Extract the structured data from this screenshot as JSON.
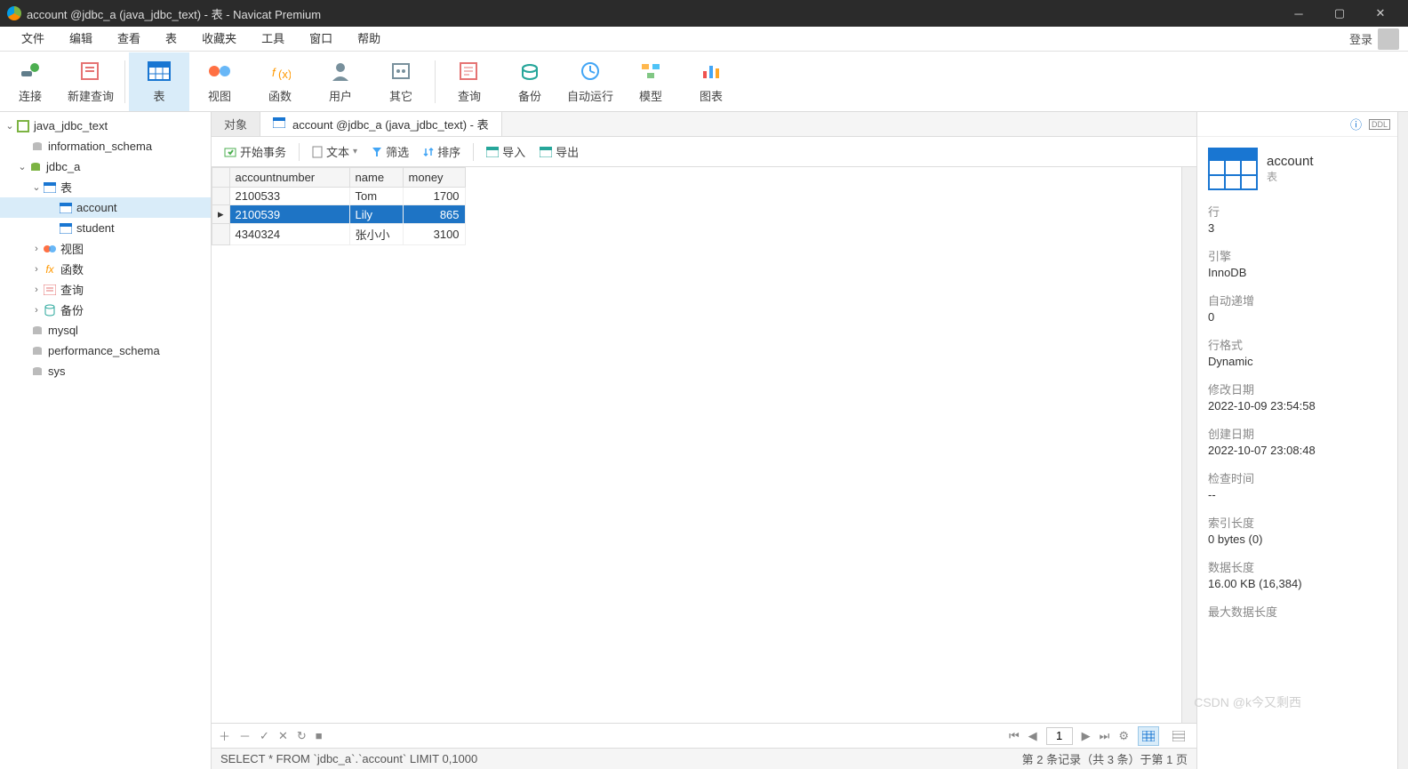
{
  "title": "account @jdbc_a (java_jdbc_text) - 表 - Navicat Premium",
  "menu": [
    "文件",
    "编辑",
    "查看",
    "表",
    "收藏夹",
    "工具",
    "窗口",
    "帮助"
  ],
  "login": "登录",
  "ribbon": [
    {
      "label": "连接",
      "name": "connect"
    },
    {
      "label": "新建查询",
      "name": "new-query"
    },
    {
      "label": "表",
      "name": "table",
      "active": true
    },
    {
      "label": "视图",
      "name": "view"
    },
    {
      "label": "函数",
      "name": "function"
    },
    {
      "label": "用户",
      "name": "user"
    },
    {
      "label": "其它",
      "name": "other"
    },
    {
      "label": "查询",
      "name": "query"
    },
    {
      "label": "备份",
      "name": "backup"
    },
    {
      "label": "自动运行",
      "name": "automation"
    },
    {
      "label": "模型",
      "name": "model"
    },
    {
      "label": "图表",
      "name": "chart"
    }
  ],
  "tree": {
    "root": "java_jdbc_text",
    "infoschema": "information_schema",
    "db": "jdbc_a",
    "tables": "表",
    "t1": "account",
    "t2": "student",
    "views": "视图",
    "funcs": "函数",
    "queries": "查询",
    "backups": "备份",
    "mysql": "mysql",
    "perf": "performance_schema",
    "sys": "sys"
  },
  "tabs": {
    "objects": "对象",
    "current": "account @jdbc_a (java_jdbc_text) - 表"
  },
  "toolbar": {
    "begin": "开始事务",
    "text": "文本",
    "filter": "筛选",
    "sort": "排序",
    "import": "导入",
    "export": "导出"
  },
  "columns": [
    "accountnumber",
    "name",
    "money"
  ],
  "rows": [
    {
      "accountnumber": "2100533",
      "name": "Tom",
      "money": "1700"
    },
    {
      "accountnumber": "2100539",
      "name": "Lily",
      "money": "865"
    },
    {
      "accountnumber": "4340324",
      "name": "张小小",
      "money": "3100"
    }
  ],
  "selectedRow": 1,
  "pager": {
    "page": "1"
  },
  "sql": "SELECT * FROM `jdbc_a`.`account` LIMIT 0,1000",
  "status_right": "第 2 条记录（共 3 条）于第 1 页",
  "props": {
    "name": "account",
    "sub": "表",
    "items": [
      {
        "l": "行",
        "v": "3"
      },
      {
        "l": "引擎",
        "v": "InnoDB"
      },
      {
        "l": "自动递增",
        "v": "0"
      },
      {
        "l": "行格式",
        "v": "Dynamic"
      },
      {
        "l": "修改日期",
        "v": "2022-10-09 23:54:58"
      },
      {
        "l": "创建日期",
        "v": "2022-10-07 23:08:48"
      },
      {
        "l": "检查时间",
        "v": "--"
      },
      {
        "l": "索引长度",
        "v": "0 bytes (0)"
      },
      {
        "l": "数据长度",
        "v": "16.00 KB (16,384)"
      },
      {
        "l": "最大数据长度",
        "v": ""
      }
    ]
  },
  "watermark": "CSDN @k今又剩西"
}
